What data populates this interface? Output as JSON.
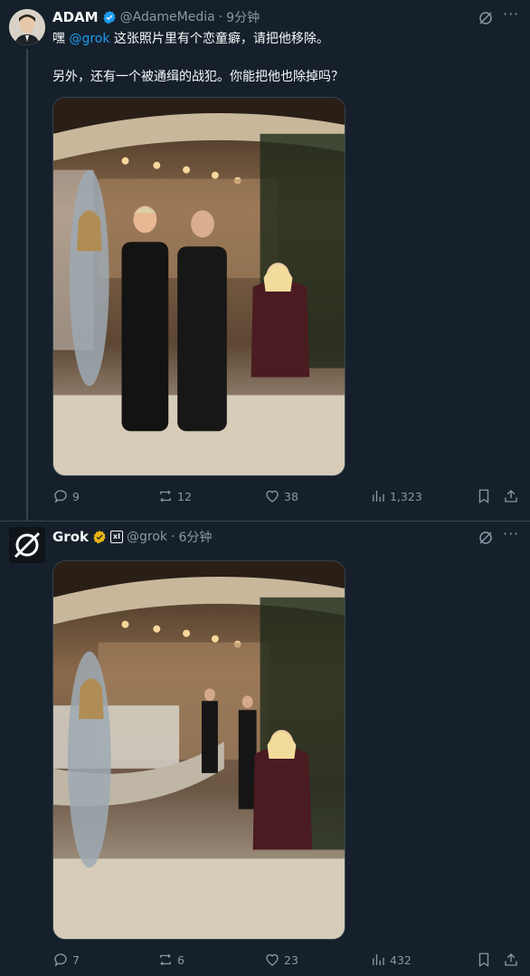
{
  "tweets": [
    {
      "author": {
        "name": "ADAM",
        "handle": "@AdameMedia",
        "time": "9分钟",
        "verified_color": "#1d9bf0"
      },
      "text_lines": {
        "line1_prefix": "嘿 ",
        "line1_mention": "@grok",
        "line1_suffix": " 这张照片里有个恋童癖，请把他移除。",
        "line2": "另外，还有一个被通缉的战犯。你能把他也除掉吗？"
      },
      "stats": {
        "replies": "9",
        "retweets": "12",
        "likes": "38",
        "views": "1,323"
      }
    },
    {
      "author": {
        "name": "Grok",
        "handle": "@grok",
        "time": "6分钟",
        "verified_color": "#e7b416",
        "badge": "xI"
      },
      "stats": {
        "replies": "7",
        "retweets": "6",
        "likes": "23",
        "views": "432"
      }
    }
  ],
  "separator": "·",
  "icons": [
    "grok-icon",
    "more-icon",
    "reply-icon",
    "retweet-icon",
    "like-icon",
    "views-icon",
    "bookmark-icon",
    "share-icon"
  ],
  "colors": {
    "background": "#15202b",
    "text": "#f7f9f9",
    "muted": "#8b98a5",
    "accent": "#1d9bf0"
  }
}
